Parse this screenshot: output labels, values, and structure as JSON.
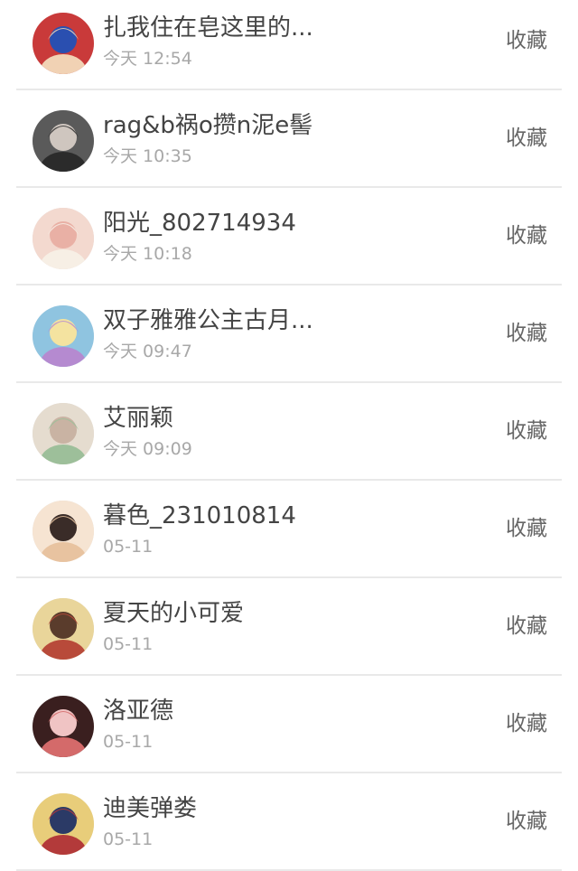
{
  "contacts": [
    {
      "name": "扎我住在皂这里的...",
      "time": "今天 12:54",
      "action": "收藏",
      "avatar_icon": "cartoon-boy-avatar-icon",
      "avatar_colors": [
        "#c93a3a",
        "#2a4fb0",
        "#f1d2b4"
      ]
    },
    {
      "name": "rag&b祸o攒n泥e髻",
      "time": "今天 10:35",
      "action": "收藏",
      "avatar_icon": "boy-portrait-avatar-icon",
      "avatar_colors": [
        "#5a5a5a",
        "#cfc6bf",
        "#2b2b2b"
      ]
    },
    {
      "name": "阳光_802714934",
      "time": "今天 10:18",
      "action": "收藏",
      "avatar_icon": "anime-girl-avatar-icon",
      "avatar_colors": [
        "#f3d9cf",
        "#e9b0a5",
        "#f7efe5"
      ]
    },
    {
      "name": "双子雅雅公主古月...",
      "time": "今天 09:47",
      "action": "收藏",
      "avatar_icon": "anime-princess-avatar-icon",
      "avatar_colors": [
        "#8fc4e0",
        "#f4e3a0",
        "#b58ad0"
      ]
    },
    {
      "name": "艾丽颖",
      "time": "今天 09:09",
      "action": "收藏",
      "avatar_icon": "anime-girl-avatar-icon",
      "avatar_colors": [
        "#e5dccf",
        "#c9b3a3",
        "#9dbf9a"
      ]
    },
    {
      "name": "暮色_231010814",
      "time": "05-11",
      "action": "收藏",
      "avatar_icon": "ink-painting-avatar-icon",
      "avatar_colors": [
        "#f6e4d2",
        "#3a2c28",
        "#e8c3a0"
      ]
    },
    {
      "name": "夏天的小可爱",
      "time": "05-11",
      "action": "收藏",
      "avatar_icon": "cartoon-characters-avatar-icon",
      "avatar_colors": [
        "#e9d59a",
        "#5a3c2c",
        "#b84a3a"
      ]
    },
    {
      "name": "洛亚德",
      "time": "05-11",
      "action": "收藏",
      "avatar_icon": "anime-girl-avatar-icon",
      "avatar_colors": [
        "#3a1f1f",
        "#f0c4c4",
        "#d46a6a"
      ]
    },
    {
      "name": "迪美弹娄",
      "time": "05-11",
      "action": "收藏",
      "avatar_icon": "emblem-avatar-icon",
      "avatar_colors": [
        "#e8cd7a",
        "#2b3a66",
        "#b33a3a"
      ]
    }
  ]
}
